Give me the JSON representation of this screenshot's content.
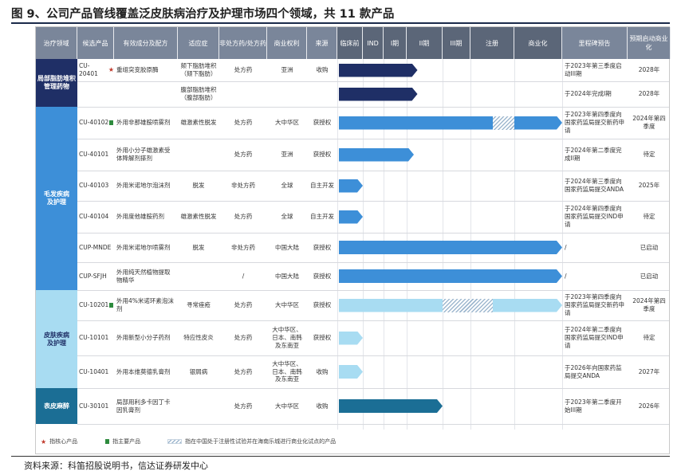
{
  "figure_title": "图 9、公司产品管线覆盖泛皮肤病治疗及护理市场四个领域，共 11 款产品",
  "source_note": "资料来源：科笛招股说明书，信达证券研发中心",
  "colors": {
    "header": "#7a869a",
    "navy": "#1f2f66",
    "blue": "#3d8fd8",
    "light_blue": "#a8dcf2",
    "teal": "#1b6e95",
    "star": "#c0392b",
    "core_square": "#2e8b3e",
    "hatch": "#9fb8cf"
  },
  "headers": [
    "治疗领域",
    "候选产品",
    "有效成分及配方",
    "适应症",
    "非处方药/处方药",
    "商业权利",
    "来源",
    "临床前",
    "IND",
    "I期",
    "II期",
    "III期",
    "注册",
    "商业化",
    "里程碑预告",
    "预期启动商业化"
  ],
  "domains": [
    {
      "label": "局部脂肪堆积\n管理药物",
      "color": "#1f2f66",
      "text_color": "#ffffff"
    },
    {
      "label": "毛发疾病\n及护理",
      "color": "#3d8fd8",
      "text_color": "#ffffff"
    },
    {
      "label": "皮肤疾病\n及护理",
      "color": "#a8dcf2",
      "text_color": "#1f2f66"
    },
    {
      "label": "表皮麻醉",
      "color": "#1b6e95",
      "text_color": "#ffffff"
    }
  ],
  "chart_data": {
    "type": "bar",
    "orientation": "horizontal",
    "title": "图 9、公司产品管线覆盖泛皮肤病治疗及护理市场四个领域，共 11 款产品",
    "stages": [
      "临床前",
      "IND",
      "I期",
      "II期",
      "III期",
      "注册",
      "商业化"
    ],
    "stage_scale_note": "progress measured in stage units: 0 = start of 临床前, 7 = end of 商业化",
    "rows": [
      {
        "product": "CU-20401",
        "star": true,
        "core": false,
        "ingredient": "重组突变胶原酶",
        "indication": "颏下脂肪堆积（颏下脂肪）",
        "otc": "处方药",
        "rights": "亚洲",
        "origin": "收购",
        "progress": 3.3,
        "hatch_from": null,
        "hatch_to": null,
        "milestone": "于2023年第三季度启动III期",
        "launch": "2028年"
      },
      {
        "product": "",
        "star": false,
        "core": false,
        "ingredient": "",
        "indication": "腹部脂肪堆积（腹部脂肪）",
        "otc": "",
        "rights": "",
        "origin": "",
        "progress": 3.3,
        "hatch_from": null,
        "hatch_to": null,
        "milestone": "于2024年完成I期",
        "launch": "2028年"
      },
      {
        "product": "CU-40102",
        "star": false,
        "core": true,
        "ingredient": "外用非那雄胺喷雾剂",
        "indication": "雄激素性脱发",
        "otc": "处方药",
        "rights": "大中华区",
        "origin": "获授权",
        "progress": 7.0,
        "hatch_from": 5.5,
        "hatch_to": 6.0,
        "milestone": "于2023年第四季度向国家药监局提交新药申请",
        "launch": "2024年第四季度"
      },
      {
        "product": "CU-40101",
        "star": false,
        "core": false,
        "ingredient": "外用小分子雄激素受体降解剂搽剂",
        "indication": "",
        "otc": "处方药",
        "rights": "亚洲",
        "origin": "获授权",
        "progress": 3.2,
        "hatch_from": null,
        "hatch_to": null,
        "milestone": "于2024年第二季度完成II期",
        "launch": "待定"
      },
      {
        "product": "CU-40103",
        "star": false,
        "core": false,
        "ingredient": "外用米诺地尔泡沫剂",
        "indication": "脱发",
        "otc": "非处方药",
        "rights": "全球",
        "origin": "自主开发",
        "progress": 1.0,
        "hatch_from": null,
        "hatch_to": null,
        "milestone": "于2024年第三季度向国家药监局提交ANDA",
        "launch": "2025年"
      },
      {
        "product": "CU-40104",
        "star": false,
        "core": false,
        "ingredient": "外用度他雄胺药剂",
        "indication": "雄激素性脱发",
        "otc": "处方药",
        "rights": "全球",
        "origin": "自主开发",
        "progress": 1.0,
        "hatch_from": null,
        "hatch_to": null,
        "milestone": "于2024年第四季度向国家药监局提交IND申请",
        "launch": "待定"
      },
      {
        "product": "CUP-MNDE",
        "star": false,
        "core": false,
        "ingredient": "外用米诺地尔喷雾剂",
        "indication": "脱发",
        "otc": "非处方药",
        "rights": "中国大陆",
        "origin": "获授权",
        "progress": 7.0,
        "hatch_from": null,
        "hatch_to": null,
        "milestone": "/",
        "launch": "已启动"
      },
      {
        "product": "CUP-SFJH",
        "star": false,
        "core": false,
        "ingredient": "外用纯天然植物提取物精华",
        "indication": "",
        "otc": "/",
        "rights": "中国大陆",
        "origin": "获授权",
        "progress": 7.0,
        "hatch_from": null,
        "hatch_to": null,
        "milestone": "/",
        "launch": "已启动"
      },
      {
        "product": "CU-10201",
        "star": false,
        "core": true,
        "ingredient": "外用4%米诺环素泡沫剂",
        "indication": "寻常痤疮",
        "otc": "处方药",
        "rights": "大中华区",
        "origin": "获授权",
        "progress": 7.0,
        "hatch_from": 4.0,
        "hatch_to": 5.5,
        "milestone": "于2023年第四季度向国家药监局提交新药申请",
        "launch": "2024年第四季度"
      },
      {
        "product": "CU-10101",
        "star": false,
        "core": false,
        "ingredient": "外用新型小分子药剂",
        "indication": "特应性皮炎",
        "otc": "处方药",
        "rights": "大中华区、日本、南韩及东南亚",
        "origin": "获授权",
        "progress": 1.0,
        "hatch_from": null,
        "hatch_to": null,
        "milestone": "于2024年第二季度向国家药监局提交IND申请",
        "launch": "待定"
      },
      {
        "product": "CU-10401",
        "star": false,
        "core": false,
        "ingredient": "外用本维莫德乳膏剂",
        "indication": "银屑病",
        "otc": "处方药",
        "rights": "大中华区、日本、南韩及东南亚",
        "origin": "收购",
        "progress": 1.0,
        "hatch_from": null,
        "hatch_to": null,
        "milestone": "于2026年向国家药监局提交ANDA",
        "launch": "2027年"
      },
      {
        "product": "CU-30101",
        "star": false,
        "core": false,
        "ingredient": "局部用利多卡因丁卡因乳膏剂",
        "indication": "",
        "otc": "处方药",
        "rights": "大中华区",
        "origin": "收购",
        "progress": 4.0,
        "hatch_from": null,
        "hatch_to": null,
        "milestone": "于2023年第二季度开始III期",
        "launch": "2026年"
      }
    ],
    "legend": [
      {
        "symbol": "star",
        "label": "指核心产品"
      },
      {
        "symbol": "square",
        "label": "指主要产品"
      },
      {
        "symbol": "hatch",
        "label": "指在中国处于注册性试验并在海南乐城进行商业化试点的产品"
      }
    ]
  }
}
